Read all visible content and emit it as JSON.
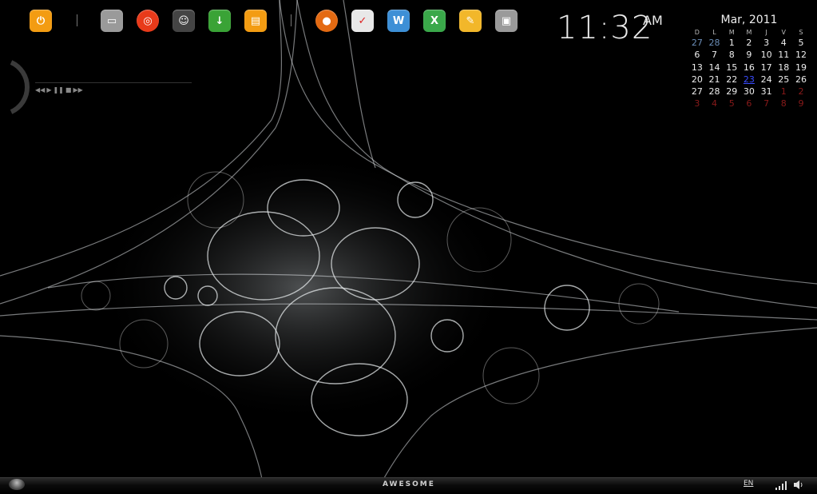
{
  "dock": {
    "items": [
      {
        "name": "power-button",
        "icon": "power-icon",
        "color": "#f39c12"
      },
      {
        "name": "computer-button",
        "icon": "computer-icon",
        "color": "#9a9a9a"
      },
      {
        "name": "rings-button",
        "icon": "rings-icon",
        "color": "#e83a1a"
      },
      {
        "name": "messenger-button",
        "icon": "messenger-icon",
        "color": "#444444"
      },
      {
        "name": "download-button",
        "icon": "download-icon",
        "color": "#3aa336"
      },
      {
        "name": "folder-button",
        "icon": "folder-icon",
        "color": "#f39c12"
      },
      {
        "name": "firefox-button",
        "icon": "firefox-icon",
        "color": "#e46a12"
      },
      {
        "name": "acrobat-button",
        "icon": "pdf-icon",
        "color": "#e8e8e8"
      },
      {
        "name": "word-button",
        "icon": "word-icon",
        "color": "#3d8fd6"
      },
      {
        "name": "excel-button",
        "icon": "excel-icon",
        "color": "#3aa84a"
      },
      {
        "name": "notes-button",
        "icon": "notes-icon",
        "color": "#f2b72a"
      },
      {
        "name": "terminal-button",
        "icon": "terminal-icon",
        "color": "#9a9a9a"
      }
    ]
  },
  "clock": {
    "time": "11:32",
    "ampm": "AM"
  },
  "calendar": {
    "month_label": "Mar, 2011",
    "weekdays": [
      "D",
      "L",
      "M",
      "M",
      "J",
      "V",
      "S"
    ],
    "today": "23",
    "weeks": [
      [
        {
          "d": "27",
          "t": "prev"
        },
        {
          "d": "28",
          "t": "prev"
        },
        {
          "d": "1"
        },
        {
          "d": "2"
        },
        {
          "d": "3"
        },
        {
          "d": "4"
        },
        {
          "d": "5"
        }
      ],
      [
        {
          "d": "6"
        },
        {
          "d": "7"
        },
        {
          "d": "8"
        },
        {
          "d": "9"
        },
        {
          "d": "10"
        },
        {
          "d": "11"
        },
        {
          "d": "12"
        }
      ],
      [
        {
          "d": "13"
        },
        {
          "d": "14"
        },
        {
          "d": "15"
        },
        {
          "d": "16"
        },
        {
          "d": "17"
        },
        {
          "d": "18"
        },
        {
          "d": "19"
        }
      ],
      [
        {
          "d": "20"
        },
        {
          "d": "21"
        },
        {
          "d": "22"
        },
        {
          "d": "23",
          "t": "today"
        },
        {
          "d": "24"
        },
        {
          "d": "25"
        },
        {
          "d": "26"
        }
      ],
      [
        {
          "d": "27"
        },
        {
          "d": "28"
        },
        {
          "d": "29"
        },
        {
          "d": "30"
        },
        {
          "d": "31"
        },
        {
          "d": "1",
          "t": "next"
        },
        {
          "d": "2",
          "t": "next"
        }
      ],
      [
        {
          "d": "3",
          "t": "next"
        },
        {
          "d": "4",
          "t": "next"
        },
        {
          "d": "5",
          "t": "next"
        },
        {
          "d": "6",
          "t": "next"
        },
        {
          "d": "7",
          "t": "next"
        },
        {
          "d": "8",
          "t": "next"
        },
        {
          "d": "9",
          "t": "next"
        }
      ]
    ]
  },
  "media": {
    "controls": [
      "rewind-icon",
      "play-icon",
      "pause-icon",
      "stop-icon",
      "forward-icon"
    ]
  },
  "taskbar": {
    "title": "AWESOME",
    "language": "EN",
    "tray": [
      "signal-icon",
      "volume-icon"
    ]
  }
}
